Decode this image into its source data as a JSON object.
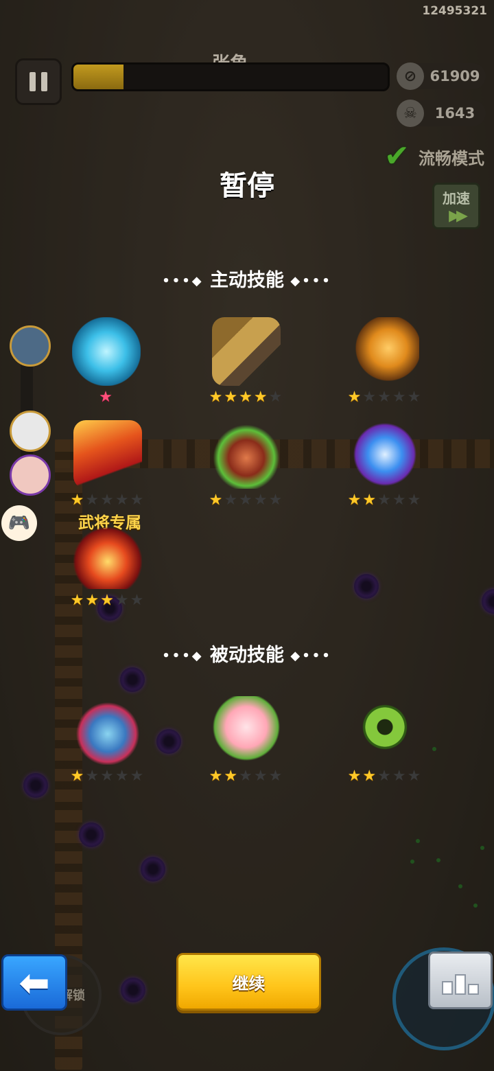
{
  "top_right_id": "12495321",
  "boss": {
    "name": "张角",
    "hp_fraction": 0.16
  },
  "counters": {
    "coins": {
      "icon": "coin-icon",
      "value": "61909"
    },
    "kills": {
      "icon": "skull-icon",
      "value": "1643"
    }
  },
  "smooth_mode": {
    "label": "流畅模式",
    "checked": true
  },
  "speed_button": {
    "label": "加速"
  },
  "pause_title": "暂停",
  "sections": {
    "active": {
      "title": "主动技能",
      "skills": [
        {
          "name": "ice-sword",
          "stars": 1,
          "star_type": "pink",
          "max_stars": 1
        },
        {
          "name": "crossbow",
          "stars": 4,
          "max_stars": 5
        },
        {
          "name": "flaming-fist",
          "stars": 1,
          "max_stars": 5
        },
        {
          "name": "fire-scroll",
          "stars": 1,
          "max_stars": 5
        },
        {
          "name": "green-tower",
          "stars": 1,
          "max_stars": 5
        },
        {
          "name": "arrow-barrage",
          "stars": 2,
          "max_stars": 5
        },
        {
          "name": "fire-blade",
          "stars": 3,
          "max_stars": 5
        }
      ],
      "exclusive_label": "武将专属"
    },
    "passive": {
      "title": "被动技能",
      "skills": [
        {
          "name": "armor",
          "stars": 1,
          "max_stars": 5
        },
        {
          "name": "peach",
          "stars": 2,
          "max_stars": 5
        },
        {
          "name": "jade-pendant",
          "stars": 2,
          "max_stars": 5
        }
      ]
    }
  },
  "bottom": {
    "continue_label": "继续",
    "unlock_label": "解锁"
  },
  "colors": {
    "star_on": "#ffc928",
    "star_off": "#3a3a3a",
    "continue_btn": "#ffc41a",
    "back_btn": "#2a88ec"
  }
}
